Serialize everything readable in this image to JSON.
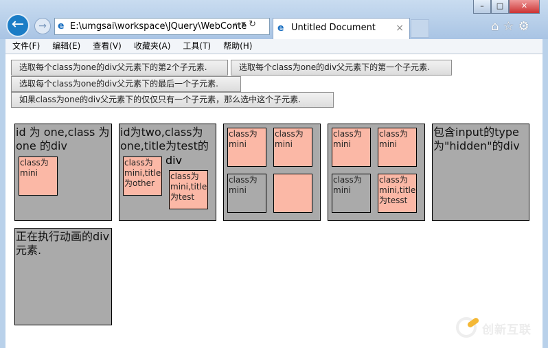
{
  "window": {
    "minimize": "–",
    "maximize": "□",
    "close": "✕"
  },
  "nav": {
    "back_icon": "←",
    "forward_icon": "→",
    "address": "E:\\umgsai\\workspace\\JQuery\\WebConte",
    "address_icons": "⌕ ▾ ↻",
    "tab_title": "Untitled Document",
    "tab_close": "×",
    "tools": "⌂☆⚙"
  },
  "menu": [
    "文件(F)",
    "编辑(E)",
    "查看(V)",
    "收藏夹(A)",
    "工具(T)",
    "帮助(H)"
  ],
  "buttons": [
    "选取每个class为one的div父元素下的第2个子元素.",
    "选取每个class为one的div父元素下的第一个子元素.",
    "选取每个class为one的div父元素下的最后一个子元素.",
    "如果class为one的div父元素下的仅仅只有一个子元素，那么选中这个子元素."
  ],
  "boxes": {
    "one": {
      "text": "id 为 one,class 为 one 的div",
      "mini": "class为 mini"
    },
    "two": {
      "text": "id为two,class为one,title为test的",
      "text2": "div",
      "mini1": "class为 mini,title为other",
      "mini2": "class为 mini,title为test"
    },
    "three": {
      "m1": "class为 mini",
      "m2": "class为 mini",
      "m3": "class为 mini",
      "m4": ""
    },
    "four": {
      "m1": "class为 mini",
      "m2": "class为 mini",
      "m3": "class为 mini",
      "m4": "class为 mini,title为tesst"
    },
    "hidden": {
      "text": "包含input的type为\"hidden\"的div"
    },
    "animated": {
      "text": "正在执行动画的div元素."
    }
  },
  "colors": {
    "box": "#aaaaaa",
    "mini": "#fbb8a6"
  },
  "watermark": "创新互联"
}
